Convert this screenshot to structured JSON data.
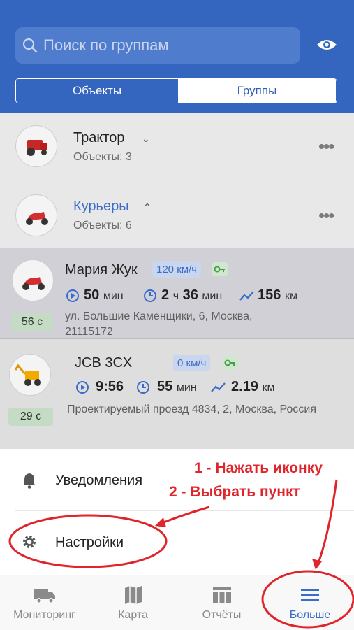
{
  "search": {
    "placeholder": "Поиск по группам"
  },
  "segments": {
    "objects": "Объекты",
    "groups": "Группы"
  },
  "groups": [
    {
      "name": "Трактор",
      "subtitle": "Объекты: 3"
    },
    {
      "name": "Курьеры",
      "subtitle": "Объекты: 6"
    }
  ],
  "objects": [
    {
      "name": "Мария Жук",
      "speed": "120 км/ч",
      "time_val": "50",
      "time_unit": "мин",
      "dur_h": "2",
      "dur_h_unit": "ч",
      "dur_m": "36",
      "dur_m_unit": "мин",
      "dist_val": "156",
      "dist_unit": "км",
      "address": "ул. Большие Каменщики, 6, Москва, 21115172",
      "age": "56 с"
    },
    {
      "name": "JCB 3CX",
      "speed": "0 км/ч",
      "time_val": "9:56",
      "time_unit": "",
      "dur_val": "55",
      "dur_unit": "мин",
      "dist_val": "2.19",
      "dist_unit": "км",
      "address": "Проектируемый проезд 4834, 2, Москва, Россия",
      "age": "29 с"
    }
  ],
  "menu": {
    "notifications": "Уведомления",
    "settings": "Настройки"
  },
  "tabs": {
    "monitoring": "Мониторинг",
    "map": "Карта",
    "reports": "Отчёты",
    "more": "Больше"
  },
  "annotations": {
    "step1": "1 - Нажать иконку",
    "step2": "2 - Выбрать пункт"
  },
  "colors": {
    "header": "#3465bf",
    "accent": "#3a6cc8",
    "annotation": "#e0242b"
  }
}
